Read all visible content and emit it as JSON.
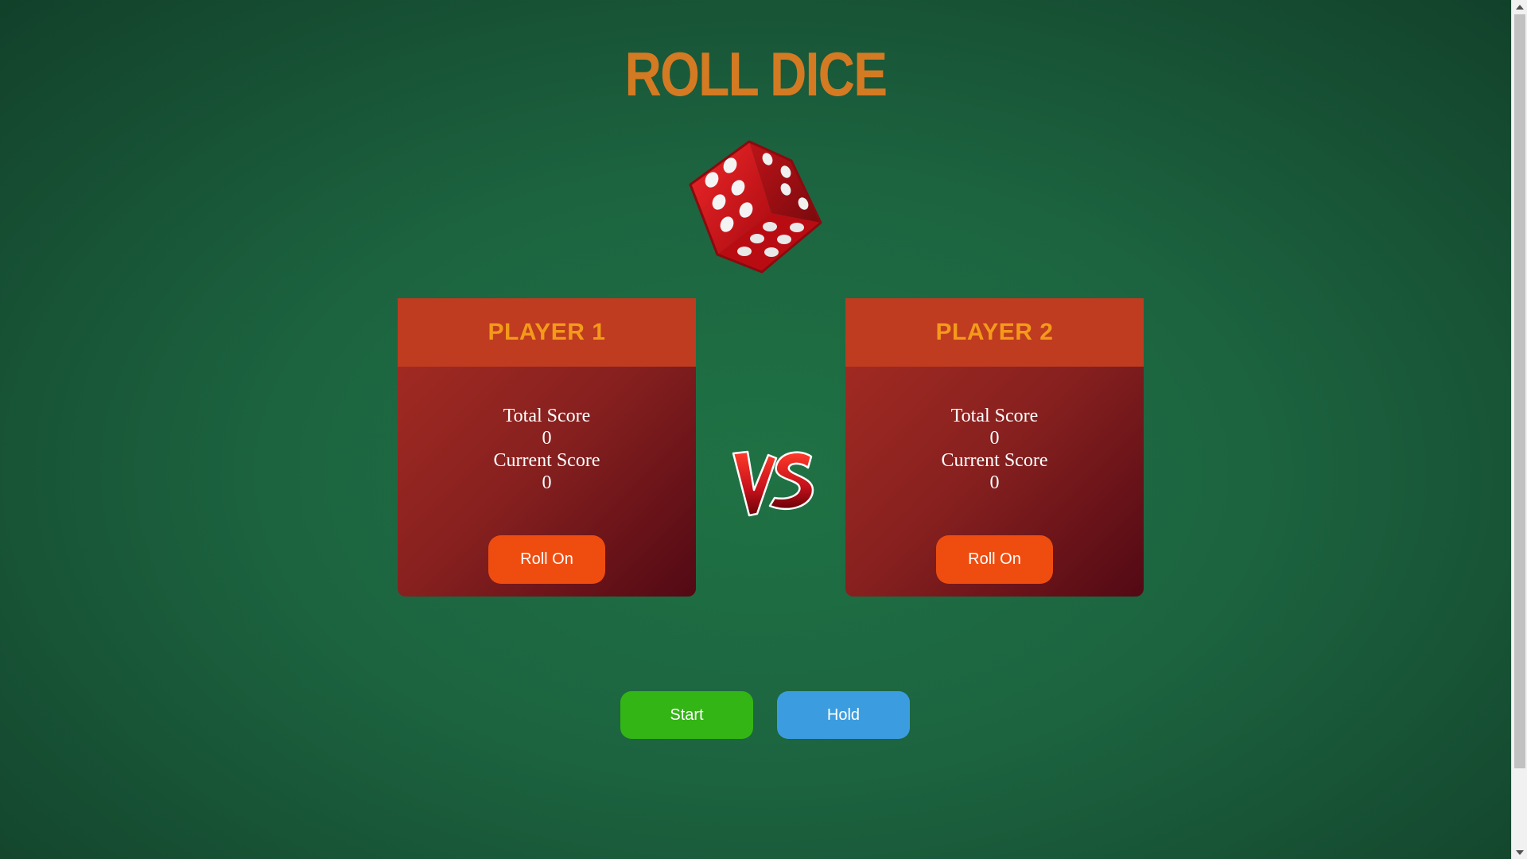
{
  "title": "ROLL DICE",
  "dice": {
    "icon": "dice-icon",
    "color": "#d4141c"
  },
  "vs_icon": "vs-icon",
  "players": [
    {
      "name": "PLAYER 1",
      "total_label": "Total Score",
      "total_value": "0",
      "current_label": "Current Score",
      "current_value": "0",
      "roll_label": "Roll On"
    },
    {
      "name": "PLAYER 2",
      "total_label": "Total Score",
      "total_value": "0",
      "current_label": "Current Score",
      "current_value": "0",
      "roll_label": "Roll On"
    }
  ],
  "controls": {
    "start_label": "Start",
    "hold_label": "Hold"
  },
  "colors": {
    "title": "#d47a22",
    "card_header": "#bf3c20",
    "player_name": "#f49a1a",
    "roll_button": "#ef4d10",
    "start_button": "#33b515",
    "hold_button": "#3b9de0"
  }
}
